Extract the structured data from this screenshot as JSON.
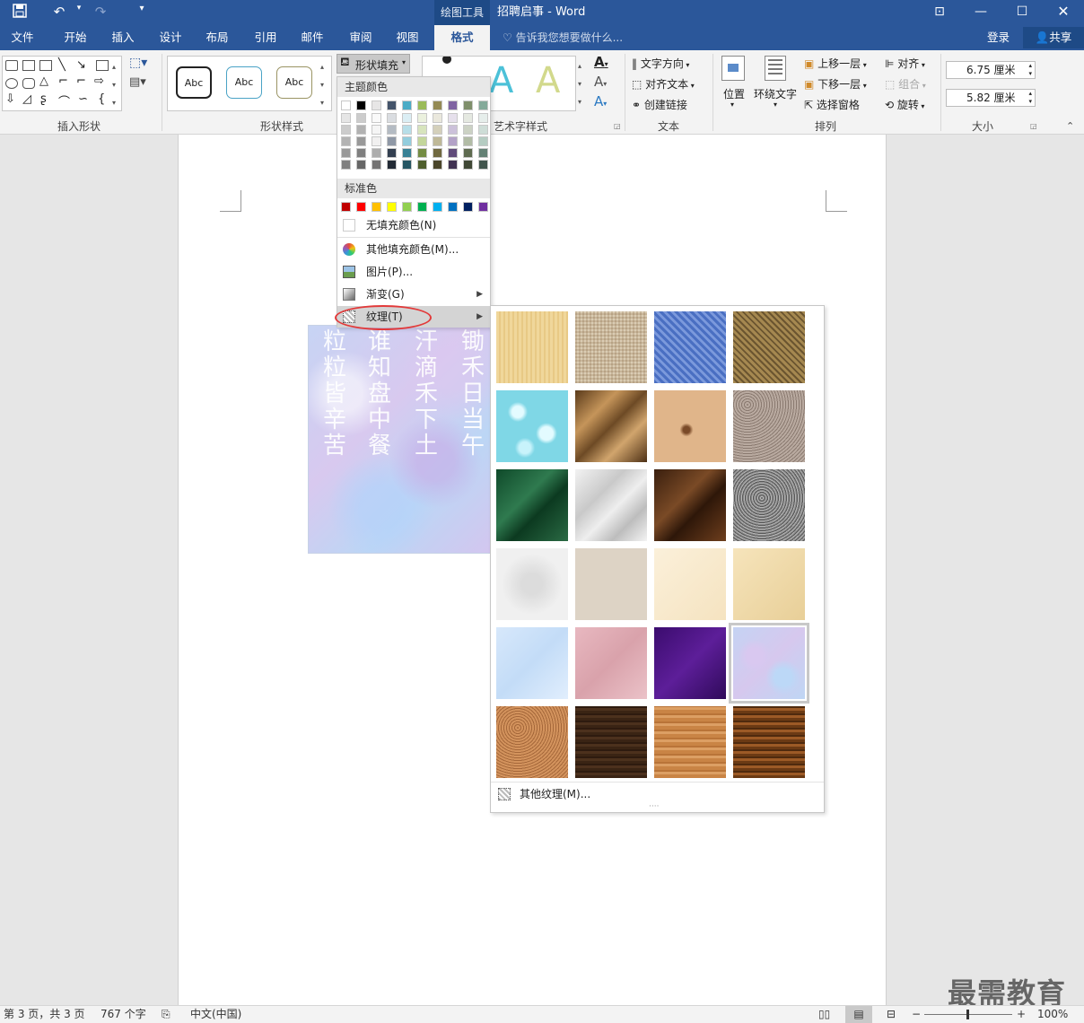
{
  "window": {
    "contextual_tab_group": "绘图工具",
    "title": "招聘启事 - Word",
    "icons": [
      "save-icon",
      "undo-icon",
      "redo-icon",
      "customize-icon",
      "ribbon-display-icon",
      "minimize-icon",
      "maximize-icon",
      "close-icon"
    ]
  },
  "tabs": [
    "文件",
    "开始",
    "插入",
    "设计",
    "布局",
    "引用",
    "邮件",
    "审阅",
    "视图",
    "格式"
  ],
  "active_tab": "格式",
  "tell_me": "告诉我您想要做什么...",
  "login": "登录",
  "share": "共享",
  "ribbon": {
    "insert_shapes_label": "插入形状",
    "shape_styles_label": "形状样式",
    "abc": [
      "Abc",
      "Abc",
      "Abc"
    ],
    "shape_fill": "形状填充",
    "wordart_label": "艺术字样式",
    "wordart_letters": [
      "A",
      "A"
    ],
    "text_direction": "文字方向",
    "align_text": "对齐文本",
    "create_link": "创建链接",
    "text_label": "文本",
    "position": "位置",
    "wrap_text": "环绕文字",
    "bring_forward": "上移一层",
    "send_backward": "下移一层",
    "selection_pane": "选择窗格",
    "align": "对齐",
    "group": "组合",
    "rotate": "旋转",
    "arrange_label": "排列",
    "height": "6.75 厘米",
    "width": "5.82 厘米",
    "size_label": "大小"
  },
  "menu": {
    "theme_colors": "主题颜色",
    "standard_colors": "标准色",
    "no_fill": "无填充颜色(N)",
    "more_colors": "其他填充颜色(M)...",
    "picture": "图片(P)...",
    "gradient": "渐变(G)",
    "texture": "纹理(T)",
    "more_textures": "其他纹理(M)...",
    "theme_top": [
      "#ffffff",
      "#000000",
      "#e7e6e6",
      "#44546a",
      "#4bacc6",
      "#9bbb59",
      "#948a54",
      "#8064a2",
      "#7f8f6b",
      "#84aa9a"
    ],
    "standard": [
      "#c00000",
      "#ff0000",
      "#ffc000",
      "#ffff00",
      "#92d050",
      "#00b050",
      "#00b0f0",
      "#0070c0",
      "#002060",
      "#7030a0"
    ]
  },
  "poem": {
    "col1": "锄禾日当午",
    "col2": "汗滴禾下土",
    "col3": "谁知盘中餐",
    "col4": "粒粒皆辛苦"
  },
  "status": {
    "page": "第 3 页，共 3 页",
    "words": "767 个字",
    "lang": "中文(中国)",
    "zoom": "100%"
  },
  "watermark": "最需教育"
}
